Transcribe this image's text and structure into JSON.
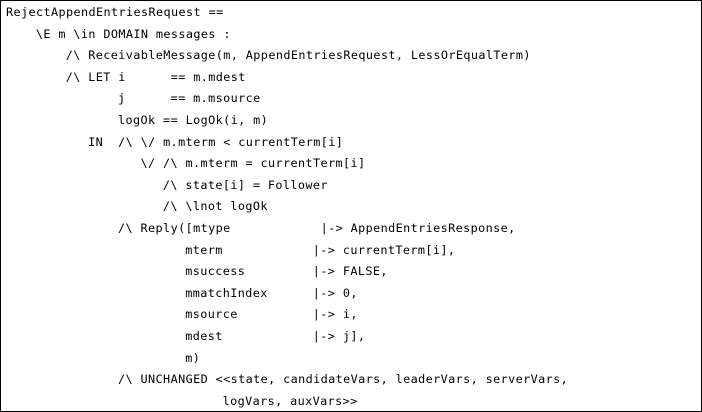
{
  "document": {
    "lines": [
      {
        "text": "RejectAppendEntriesRequest ==",
        "indent": 0
      },
      {
        "text": "\\E m \\in DOMAIN messages :",
        "indent": 4
      },
      {
        "text": "/\\ ReceivableMessage(m, AppendEntriesRequest, LessOrEqualTerm)",
        "indent": 8
      },
      {
        "text": "/\\ LET i      == m.mdest",
        "indent": 8
      },
      {
        "text": "j      == m.msource",
        "indent": 15
      },
      {
        "text": "logOk == LogOk(i, m)",
        "indent": 15
      },
      {
        "text": "IN  /\\ \\/ m.mterm < currentTerm[i]",
        "indent": 11
      },
      {
        "text": "\\/ /\\ m.mterm = currentTerm[i]",
        "indent": 18
      },
      {
        "text": "/\\ state[i] = Follower",
        "indent": 21
      },
      {
        "text": "/\\ \\lnot logOk",
        "indent": 21
      },
      {
        "text": "/\\ Reply([mtype            |-> AppendEntriesResponse,",
        "indent": 15
      },
      {
        "text": "mterm            |-> currentTerm[i],",
        "indent": 24
      },
      {
        "text": "msuccess         |-> FALSE,",
        "indent": 24
      },
      {
        "text": "mmatchIndex      |-> 0,",
        "indent": 24
      },
      {
        "text": "msource          |-> i,",
        "indent": 24
      },
      {
        "text": "mdest            |-> j],",
        "indent": 24
      },
      {
        "text": "m)",
        "indent": 24
      },
      {
        "text": "/\\ UNCHANGED <<state, candidateVars, leaderVars, serverVars,",
        "indent": 15
      },
      {
        "text": "logVars, auxVars>>",
        "indent": 29
      }
    ]
  }
}
